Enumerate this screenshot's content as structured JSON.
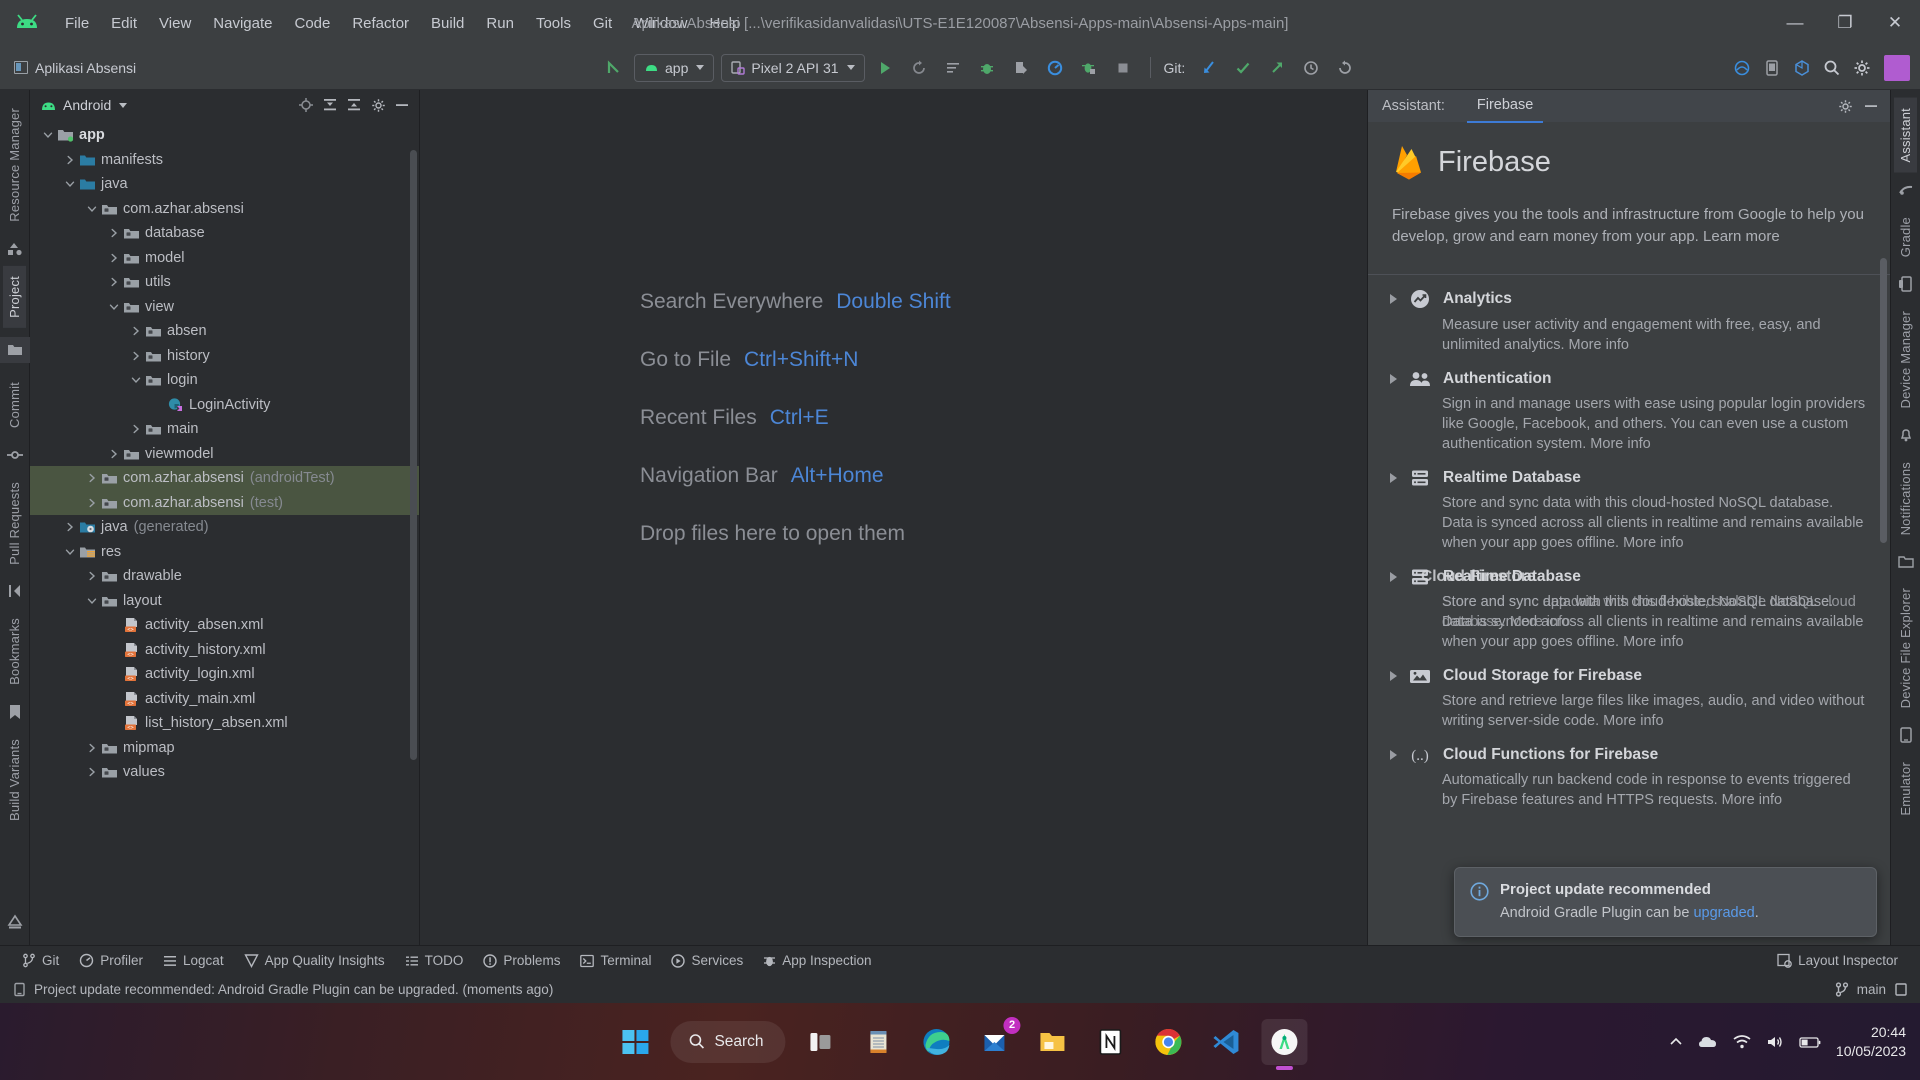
{
  "titlebar": {
    "menus": [
      "File",
      "Edit",
      "View",
      "Navigate",
      "Code",
      "Refactor",
      "Build",
      "Run",
      "Tools",
      "Git",
      "Window",
      "Help"
    ],
    "window_title": "Aplikasi Absensi [...\\verifikasidanvalidasi\\UTS-E1E120087\\Absensi-Apps-main\\Absensi-Apps-main]",
    "minimize": "—",
    "maximize": "❐",
    "close": "✕"
  },
  "toolbar": {
    "project_chip": "Aplikasi Absensi",
    "run_config": "app",
    "device": "Pixel 2 API 31",
    "git_label": "Git:",
    "icons": [
      "run-icon",
      "rerun-icon",
      "edit-config-icon",
      "debug-icon",
      "profile-icon",
      "inspect-icon",
      "run-coverage-icon",
      "stop-icon"
    ],
    "git_icons": [
      "update-project-icon",
      "commit-icon",
      "push-icon",
      "history-icon",
      "rollback-icon"
    ],
    "right_icons": [
      "device-manager-icon",
      "avd-icon",
      "sdk-icon",
      "search-icon",
      "settings-icon"
    ]
  },
  "left_strip": {
    "tabs": [
      "Resource Manager",
      "Project",
      "Commit",
      "Pull Requests",
      "Bookmarks",
      "Build Variants"
    ]
  },
  "right_strip": {
    "tabs": [
      "Assistant",
      "Gradle",
      "Device Manager",
      "Notifications",
      "Device File Explorer",
      "Emulator"
    ]
  },
  "project_panel": {
    "title": "Android",
    "header_icons": [
      "target-icon",
      "expand-all-icon",
      "collapse-all-icon",
      "settings-icon",
      "hide-icon"
    ],
    "tree": [
      {
        "depth": 0,
        "arrow": "down",
        "icon": "module-folder",
        "label": "app",
        "bold": true
      },
      {
        "depth": 1,
        "arrow": "right",
        "icon": "blue-folder",
        "label": "manifests"
      },
      {
        "depth": 1,
        "arrow": "down",
        "icon": "blue-folder",
        "label": "java"
      },
      {
        "depth": 2,
        "arrow": "down",
        "icon": "package",
        "label": "com.azhar.absensi"
      },
      {
        "depth": 3,
        "arrow": "right",
        "icon": "package",
        "label": "database"
      },
      {
        "depth": 3,
        "arrow": "right",
        "icon": "package",
        "label": "model"
      },
      {
        "depth": 3,
        "arrow": "right",
        "icon": "package",
        "label": "utils"
      },
      {
        "depth": 3,
        "arrow": "down",
        "icon": "package",
        "label": "view"
      },
      {
        "depth": 4,
        "arrow": "right",
        "icon": "package",
        "label": "absen"
      },
      {
        "depth": 4,
        "arrow": "right",
        "icon": "package",
        "label": "history"
      },
      {
        "depth": 4,
        "arrow": "down",
        "icon": "package",
        "label": "login"
      },
      {
        "depth": 5,
        "arrow": "none",
        "icon": "activity-class",
        "label": "LoginActivity"
      },
      {
        "depth": 4,
        "arrow": "right",
        "icon": "package",
        "label": "main"
      },
      {
        "depth": 3,
        "arrow": "right",
        "icon": "package",
        "label": "viewmodel"
      },
      {
        "depth": 2,
        "arrow": "right",
        "icon": "package",
        "label": "com.azhar.absensi",
        "suffix": "(androidTest)",
        "highlight": true
      },
      {
        "depth": 2,
        "arrow": "right",
        "icon": "package",
        "label": "com.azhar.absensi",
        "suffix": "(test)",
        "highlight": true
      },
      {
        "depth": 1,
        "arrow": "right",
        "icon": "generated-folder",
        "label": "java",
        "suffix": "(generated)"
      },
      {
        "depth": 1,
        "arrow": "down",
        "icon": "res-folder",
        "label": "res"
      },
      {
        "depth": 2,
        "arrow": "right",
        "icon": "package",
        "label": "drawable"
      },
      {
        "depth": 2,
        "arrow": "down",
        "icon": "package",
        "label": "layout"
      },
      {
        "depth": 3,
        "arrow": "none",
        "icon": "xml-file",
        "label": "activity_absen.xml"
      },
      {
        "depth": 3,
        "arrow": "none",
        "icon": "xml-file",
        "label": "activity_history.xml"
      },
      {
        "depth": 3,
        "arrow": "none",
        "icon": "xml-file",
        "label": "activity_login.xml"
      },
      {
        "depth": 3,
        "arrow": "none",
        "icon": "xml-file",
        "label": "activity_main.xml"
      },
      {
        "depth": 3,
        "arrow": "none",
        "icon": "xml-file",
        "label": "list_history_absen.xml"
      },
      {
        "depth": 2,
        "arrow": "right",
        "icon": "package",
        "label": "mipmap"
      },
      {
        "depth": 2,
        "arrow": "right",
        "icon": "package",
        "label": "values"
      }
    ]
  },
  "editor": {
    "hints": [
      {
        "action": "Search Everywhere",
        "shortcut": "Double Shift"
      },
      {
        "action": "Go to File",
        "shortcut": "Ctrl+Shift+N"
      },
      {
        "action": "Recent Files",
        "shortcut": "Ctrl+E"
      },
      {
        "action": "Navigation Bar",
        "shortcut": "Alt+Home"
      },
      {
        "action": "Drop files here to open them",
        "shortcut": ""
      }
    ]
  },
  "assistant": {
    "header_label": "Assistant:",
    "tab": "Firebase",
    "header_icons": [
      "settings-icon",
      "hide-icon"
    ],
    "logo_name": "firebase-logo-icon",
    "title": "Firebase",
    "intro": "Firebase gives you the tools and infrastructure from Google to help you develop, grow and earn money from your app. Learn more",
    "features": [
      {
        "icon": "analytics-icon",
        "title": "Analytics",
        "desc": "Measure user activity and engagement with free, easy, and unlimited analytics. More info"
      },
      {
        "icon": "authentication-icon",
        "title": "Authentication",
        "desc": "Sign in and manage users with ease using popular login providers like Google, Facebook, and others. You can even use a custom authentication system. More info"
      },
      {
        "icon": "database-icon",
        "title": "Realtime Database",
        "desc": "Store and sync data with this cloud-hosted NoSQL database. Data is synced across all clients in realtime and remains available when your app goes offline. More info"
      },
      {
        "icon": "database-icon",
        "title": "Realtime Database",
        "desc": "Store and sync data with this cloud-hosted NoSQL database. Data is synced across all clients in realtime and remains available when your app goes offline. More info",
        "glitch_overlay": {
          "title": "Cloud Firestore",
          "desc": "Store and sync app data with this flexible, scalable NoSQL cloud database. More info"
        }
      },
      {
        "icon": "storage-icon",
        "title": "Cloud Storage for Firebase",
        "desc": "Store and retrieve large files like images, audio, and video without writing server-side code. More info"
      },
      {
        "icon": "functions-icon",
        "title": "Cloud Functions for Firebase",
        "desc": "Automatically run backend code in response to events triggered by Firebase features and HTTPS requests. More info"
      }
    ]
  },
  "notification": {
    "icon": "info-icon",
    "title": "Project update recommended",
    "text_before": "Android Gradle Plugin can be ",
    "link": "upgraded",
    "text_after": "."
  },
  "bottombar": {
    "items": [
      {
        "icon": "git-icon",
        "label": "Git"
      },
      {
        "icon": "profiler-icon",
        "label": "Profiler"
      },
      {
        "icon": "logcat-icon",
        "label": "Logcat"
      },
      {
        "icon": "app-quality-icon",
        "label": "App Quality Insights"
      },
      {
        "icon": "todo-icon",
        "label": "TODO"
      },
      {
        "icon": "problems-icon",
        "label": "Problems"
      },
      {
        "icon": "terminal-icon",
        "label": "Terminal"
      },
      {
        "icon": "services-icon",
        "label": "Services"
      },
      {
        "icon": "app-inspection-icon",
        "label": "App Inspection"
      }
    ],
    "right": {
      "icon": "layout-inspector-icon",
      "label": "Layout Inspector"
    }
  },
  "statusbar": {
    "icon": "notification-icon",
    "message": "Project update recommended: Android Gradle Plugin can be upgraded. (moments ago)",
    "branch_icon": "branch-icon",
    "branch": "main",
    "right_icon": "memory-icon"
  },
  "taskbar": {
    "start_icon": "windows-start-icon",
    "search_placeholder": "Search",
    "apps": [
      {
        "name": "task-view-icon"
      },
      {
        "name": "calendar-icon"
      },
      {
        "name": "edge-icon",
        "running": true
      },
      {
        "name": "mail-icon",
        "badge": "2"
      },
      {
        "name": "file-explorer-icon"
      },
      {
        "name": "notion-icon",
        "running": true
      },
      {
        "name": "chrome-icon"
      },
      {
        "name": "vscode-icon",
        "running": true
      },
      {
        "name": "android-studio-icon",
        "active": true,
        "running": true
      }
    ],
    "tray": [
      "chevron-up-icon",
      "onedrive-icon",
      "wifi-icon",
      "volume-icon",
      "battery-icon"
    ],
    "time": "20:44",
    "date": "10/05/2023"
  },
  "colors": {
    "accent_blue": "#4c86d6",
    "firebase_orange": "#ffa000",
    "highlight_green": "#4a5541",
    "panel_bg": "#3c3f41",
    "window_bg": "#2b2d30"
  }
}
